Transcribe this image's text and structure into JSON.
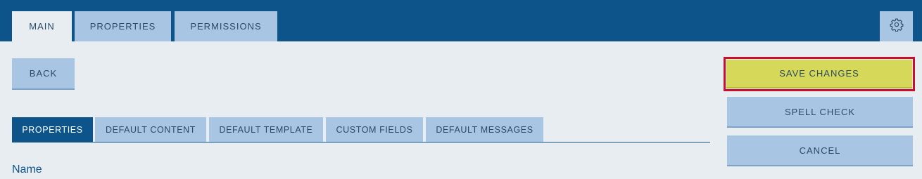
{
  "top_tabs": [
    {
      "label": "MAIN",
      "active": true
    },
    {
      "label": "PROPERTIES",
      "active": false
    },
    {
      "label": "PERMISSIONS",
      "active": false
    }
  ],
  "settings_icon": "gear-icon",
  "buttons": {
    "back": "BACK",
    "save": "SAVE CHANGES",
    "spell_check": "SPELL CHECK",
    "cancel": "CANCEL"
  },
  "sub_tabs": [
    {
      "label": "PROPERTIES",
      "active": true
    },
    {
      "label": "DEFAULT CONTENT",
      "active": false
    },
    {
      "label": "DEFAULT TEMPLATE",
      "active": false
    },
    {
      "label": "CUSTOM FIELDS",
      "active": false
    },
    {
      "label": "DEFAULT MESSAGES",
      "active": false
    }
  ],
  "form": {
    "name_label": "Name"
  },
  "colors": {
    "header": "#0c5489",
    "tab": "#a8c6e4",
    "save_button": "#d6d85a",
    "highlight_outline": "#c8102e"
  }
}
